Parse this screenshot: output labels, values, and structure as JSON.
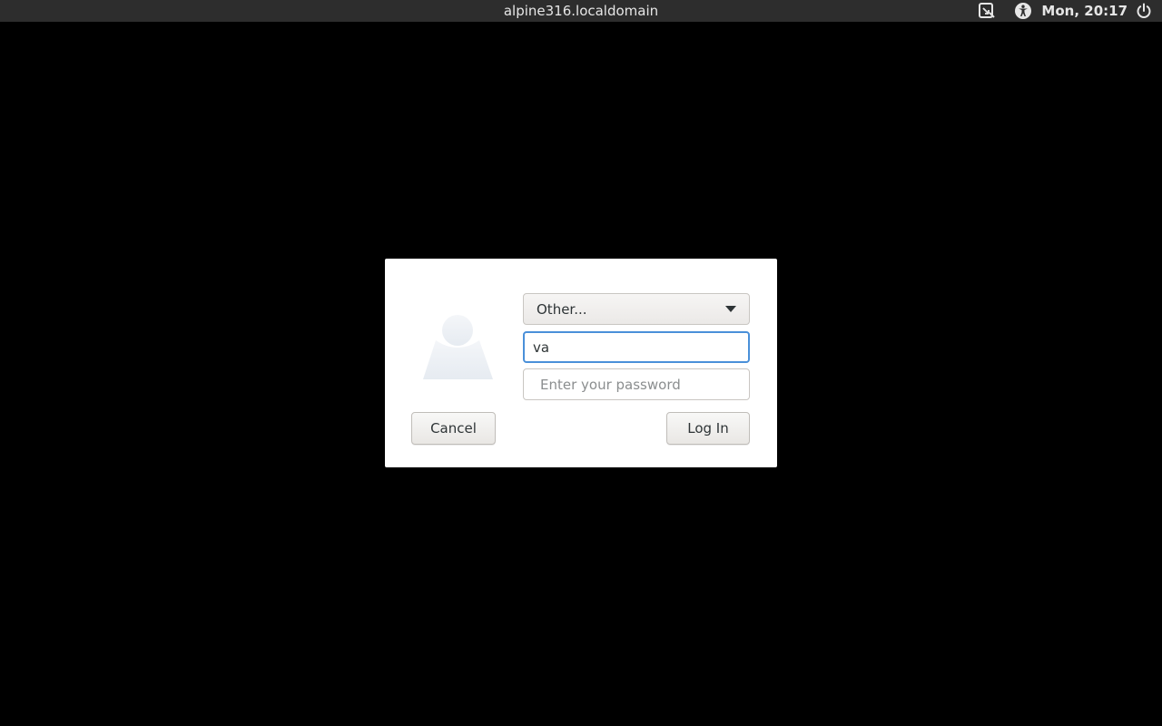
{
  "topbar": {
    "hostname": "alpine316.localdomain",
    "clock": "Mon, 20:17",
    "icons": {
      "keyboard": "screen-keyboard-icon",
      "accessibility": "accessibility-icon",
      "power": "power-icon"
    }
  },
  "login_dialog": {
    "avatar_icon": "user-avatar-icon",
    "user_select": {
      "selected": "Other..."
    },
    "username": {
      "value": "va"
    },
    "password": {
      "value": "",
      "placeholder": "Enter your password"
    },
    "cancel_label": "Cancel",
    "login_label": "Log In"
  },
  "colors": {
    "background": "#000000",
    "topbar": "#2d2d2d",
    "focus_accent": "#4a90d9"
  }
}
